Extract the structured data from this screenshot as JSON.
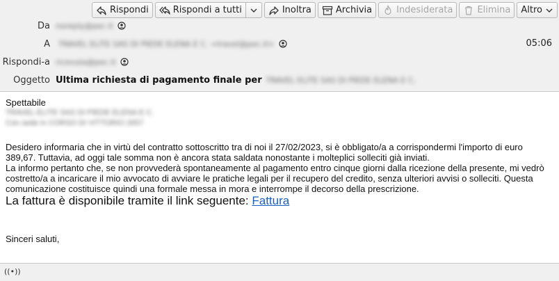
{
  "toolbar": {
    "reply": "Rispondi",
    "reply_all": "Rispondi a tutti",
    "forward": "Inoltra",
    "archive": "Archivia",
    "junk": "Indesiderata",
    "delete": "Elimina",
    "more": "Altro"
  },
  "headers": {
    "from_label": "Da",
    "from_value": "noreply@pec.it",
    "to_label": "A",
    "to_value": "TRAVEL ELITE SAS DI PIEDE ELENA E C. <travel@pec.it>",
    "reply_to_label": "Rispondi-a",
    "reply_to_value": "ricevuta@pec.it",
    "subject_label": "Oggetto",
    "subject_value": "Ultima richiesta di pagamento finale per",
    "subject_blurred": "TRAVEL ELITE SAS DI PIEDE ELENA E C.",
    "time": "05:06"
  },
  "body": {
    "greeting": "Spettabile",
    "recipient_line1": "TRAVEL ELITE SAS DI PIEDE ELENA E C.",
    "recipient_line2": "Con sede in CORSO DI VITTORIO 2657",
    "para1": "Desidero informaria che in virtù del contratto sottoscritto tra di noi il 27/02/2023, si è obbligato/a a corrispondermi l'importo di euro 389,67. Tuttavia, ad oggi tale somma non è ancora stata saldata nonostante i molteplici solleciti già inviati.",
    "para2": "La informo pertanto che, se non provvederà spontaneamente al pagamento entro cinque giorni dalla ricezione della presente, mi vedrò costretto/a a incaricare il mio avvocato di avviare le pratiche legali per il recupero del credito, senza ulteriori avvisi o solleciti. Questa comunicazione costituisce quindi una formale messa in mora e interrompe il decorso della prescrizione.",
    "invoice_text": "La fattura è disponibile tramite il link seguente: ",
    "invoice_link": "Fattura",
    "closing": "Sinceri saluti,"
  },
  "icons": {
    "reply": "reply-icon",
    "reply_all": "reply-all-icon",
    "forward": "forward-icon",
    "archive": "archive-icon",
    "junk": "junk-icon",
    "delete": "trash-icon",
    "person": "contact-icon",
    "status": "wifi-icon"
  },
  "colors": {
    "link": "#1a5fbf",
    "header_bg": "#f0f0f0"
  }
}
